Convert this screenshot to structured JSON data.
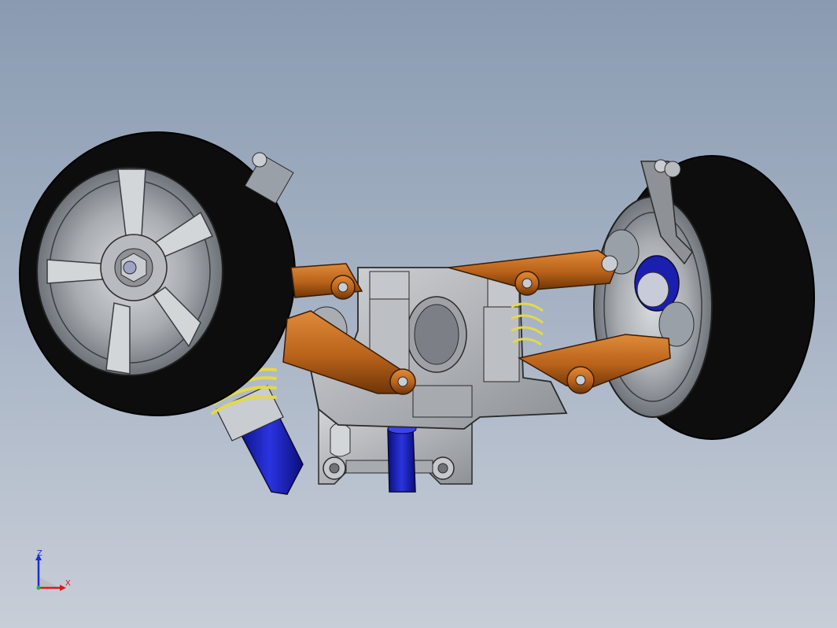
{
  "viewport": {
    "model": "rc-front-suspension-assembly",
    "background_top": "#8a9bb1",
    "background_bottom": "#c8ced8"
  },
  "parts_colors": {
    "tire": "#0d0d0d",
    "rim": "#b9bcc0",
    "arm": "#c06a1a",
    "bulkhead": "#b2b4b8",
    "shock_body": "#1a1fb0",
    "spring": "#e3d94a",
    "steel": "#9aa0a8"
  },
  "triad": {
    "z_label": "Z",
    "x_label": "X",
    "z_color": "#1a2bd8",
    "x_color": "#d81a1a"
  }
}
